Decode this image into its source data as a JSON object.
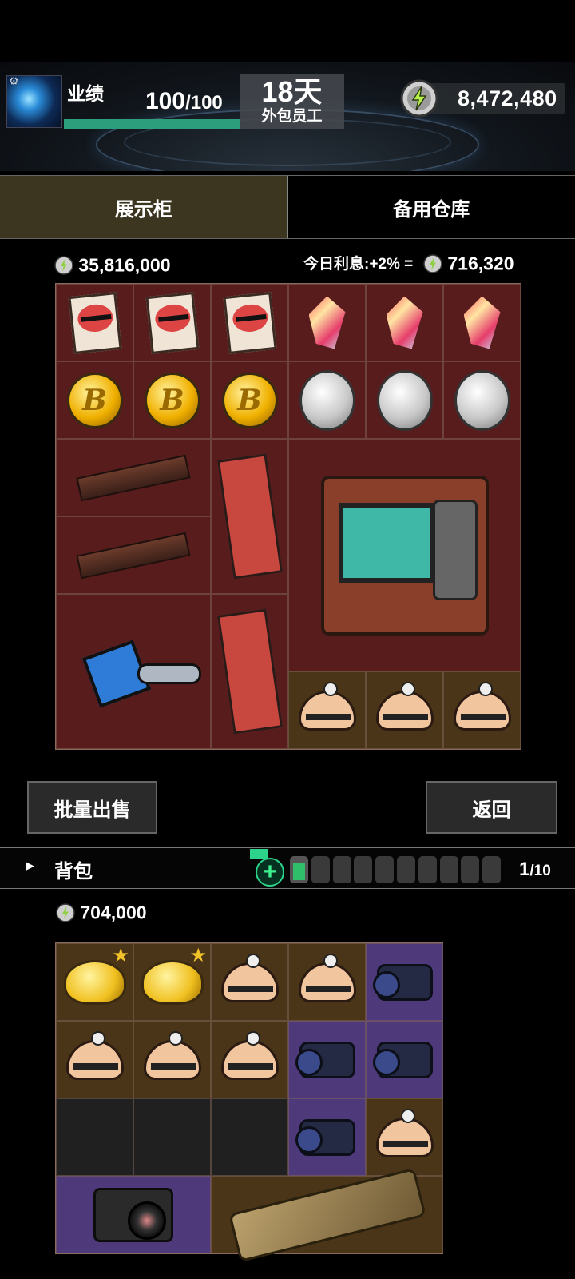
{
  "header": {
    "performance_label": "业绩",
    "performance_current": "100",
    "performance_max": "/100",
    "performance_fill": 1.0,
    "days_value": "18天",
    "days_label": "外包员工",
    "money": "8,472,480"
  },
  "tabs": {
    "display": "展示柜",
    "storage": "备用仓库",
    "active": "display"
  },
  "display": {
    "total": "35,816,000",
    "interest_label": "今日利息:+2% =",
    "interest_value": "716,320"
  },
  "buttons": {
    "sell": "批量出售",
    "back": "返回"
  },
  "backpack": {
    "title": "背包",
    "battery_slots_filled": 1,
    "battery_slots_total": 10,
    "count_current": "1",
    "count_max": "/10",
    "total": "704,000"
  },
  "icons": {
    "coin": "lightning-coin-icon",
    "settings": "gear-icon",
    "expand": "triangle-right-icon",
    "add": "plus-icon",
    "favorite": "star-icon"
  },
  "colors": {
    "maroon_cell": "#581c1c",
    "brown_cell": "#4a3518",
    "purple_cell": "#4e3a7a",
    "empty_cell": "#202020",
    "progress": "#2d9e7c",
    "accent_green": "#2bd48a"
  }
}
